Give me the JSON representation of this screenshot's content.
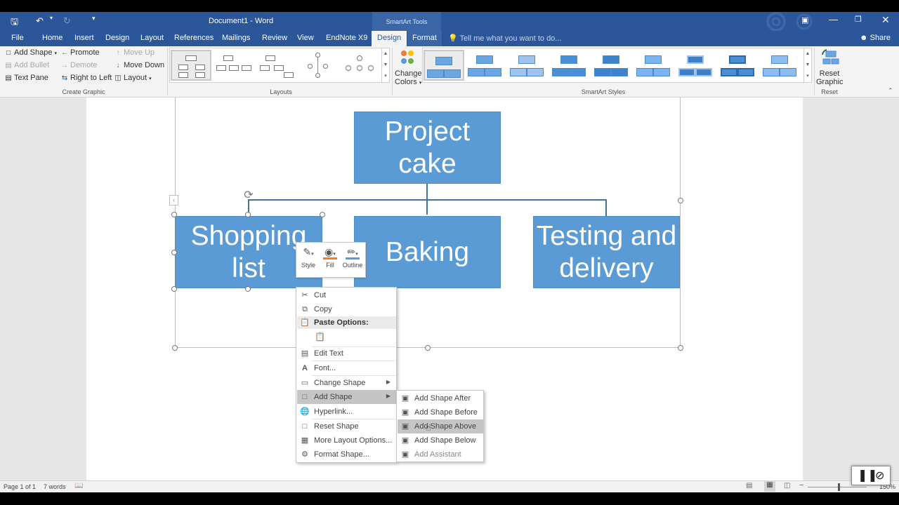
{
  "title_bar": {
    "document_title": "Document1 - Word",
    "contextual_group": "SmartArt Tools",
    "save_icon": "save-icon",
    "undo_icon": "undo-icon",
    "redo_icon": "redo-icon",
    "customize_icon": "customize-quick-access-icon"
  },
  "tabs": {
    "items": [
      "File",
      "Home",
      "Insert",
      "Design",
      "Layout",
      "References",
      "Mailings",
      "Review",
      "View",
      "EndNote X9",
      "Design",
      "Format"
    ],
    "active_index": 10,
    "tell_me": "Tell me what you want to do...",
    "share": "Share"
  },
  "ribbon": {
    "create_graphic": {
      "label": "Create Graphic",
      "add_shape": "Add Shape",
      "add_bullet": "Add Bullet",
      "text_pane": "Text Pane",
      "promote": "Promote",
      "demote": "Demote",
      "right_to_left": "Right to Left",
      "move_up": "Move Up",
      "move_down": "Move Down",
      "layout": "Layout"
    },
    "layouts": {
      "label": "Layouts"
    },
    "change_colors": {
      "line1": "Change",
      "line2": "Colors"
    },
    "smartart_styles": {
      "label": "SmartArt Styles"
    },
    "reset": {
      "label": "Reset",
      "line1": "Reset",
      "line2": "Graphic"
    }
  },
  "diagram": {
    "top": {
      "line1": "Project",
      "line2": "cake"
    },
    "left": {
      "line1": "Shopping",
      "line2": "list"
    },
    "middle": {
      "line1": "Baking"
    },
    "right": {
      "line1": "Testing and",
      "line2": "delivery"
    },
    "node_color": "#5b9bd5",
    "connector_color": "#41729f"
  },
  "mini_toolbar": {
    "style": "Style",
    "fill": "Fill",
    "outline": "Outline",
    "fill_color": "#ed7d31",
    "outline_color": "#5b9bd5"
  },
  "context_menu": {
    "cut": "Cut",
    "copy": "Copy",
    "paste_options": "Paste Options:",
    "edit_text": "Edit Text",
    "font": "Font...",
    "change_shape": "Change Shape",
    "add_shape": "Add Shape",
    "hyperlink": "Hyperlink...",
    "reset_shape": "Reset Shape",
    "more_layout": "More Layout Options...",
    "format_shape": "Format Shape..."
  },
  "submenu": {
    "after": "Add Shape After",
    "before": "Add Shape Before",
    "above": "Add Shape Above",
    "below": "Add Shape Below",
    "assistant": "Add Assistant"
  },
  "status_bar": {
    "page": "Page 1 of 1",
    "words": "7 words",
    "zoom": "150%"
  }
}
